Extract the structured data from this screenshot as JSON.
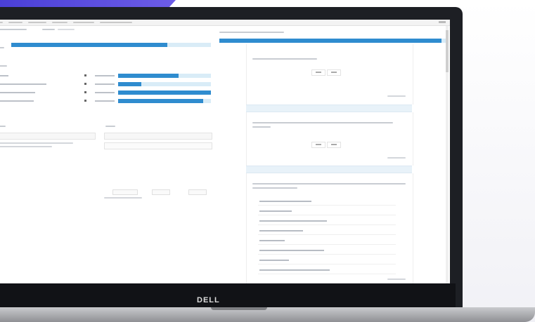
{
  "brand": {
    "logo_text": "DELL"
  },
  "app": {
    "menu_items": [
      "",
      "",
      "",
      "",
      "",
      "",
      ""
    ],
    "left_pane": {
      "top_progress_percent": 78,
      "rows": [
        {
          "checked": true,
          "bar_fill": 0.65
        },
        {
          "checked": true,
          "bar_fill": 0.25
        },
        {
          "checked": true,
          "bar_fill": 1.0
        },
        {
          "checked": true,
          "bar_fill": 0.92
        }
      ]
    },
    "right_pane": {
      "header_progress_percent": 98,
      "cards": [
        {
          "yes_no": true
        },
        {
          "yes_no": true
        },
        {
          "options_count": 8
        }
      ]
    }
  }
}
